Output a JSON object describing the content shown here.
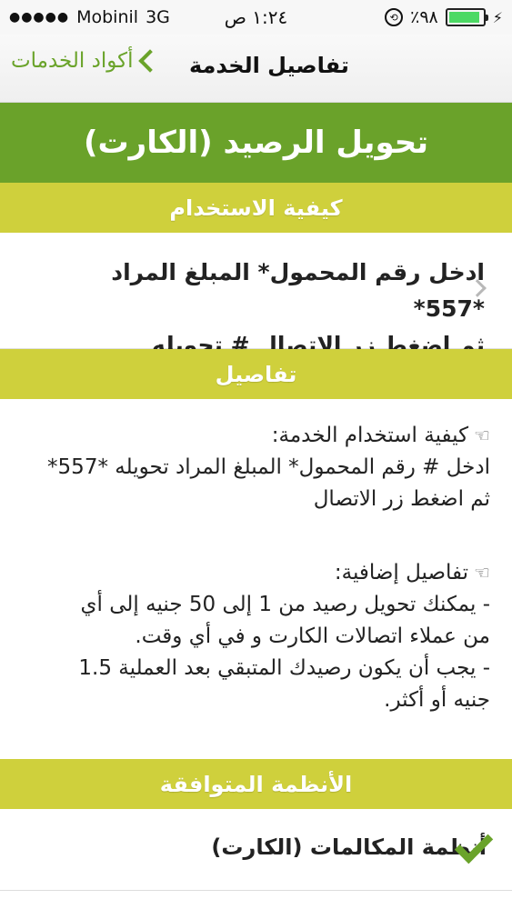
{
  "status_bar": {
    "carrier": "Mobinil",
    "network": "3G",
    "time": "١:٢٤ ص",
    "battery": "٪٩٨"
  },
  "nav": {
    "back_label": "أكواد الخدمات",
    "title": "تفاصيل الخدمة"
  },
  "service": {
    "title": "تحويل الرصيد (الكارت)"
  },
  "sections": {
    "usage_header": "كيفية الاستخدام",
    "details_header": "تفاصيل",
    "systems_header": "الأنظمة المتوافقة"
  },
  "usage": {
    "line1": "ادخل رقم المحمول* المبلغ المراد *557*",
    "line2": "ثم اضغط زر الاتصال # تحويله"
  },
  "details": {
    "how_title": "كيفية استخدام الخدمة:",
    "how_line1": "ادخل # رقم المحمول* المبلغ المراد تحويله *557*",
    "how_line2": "ثم اضغط زر الاتصال",
    "extra_title": "تفاصيل إضافية:",
    "extra_line1": "- يمكنك تحويل رصيد من 1 إلى 50 جنيه إلى أي",
    "extra_line2": "من عملاء اتصالات الكارت و في أي وقت.",
    "extra_line3": "- يجب أن يكون رصيدك المتبقي بعد العملية 1.5",
    "extra_line4": "جنيه أو أكثر."
  },
  "systems": {
    "item1": "أنظمة المكالمات (الكارت)"
  },
  "colors": {
    "green": "#6aa22a",
    "section": "#cfd03c"
  }
}
